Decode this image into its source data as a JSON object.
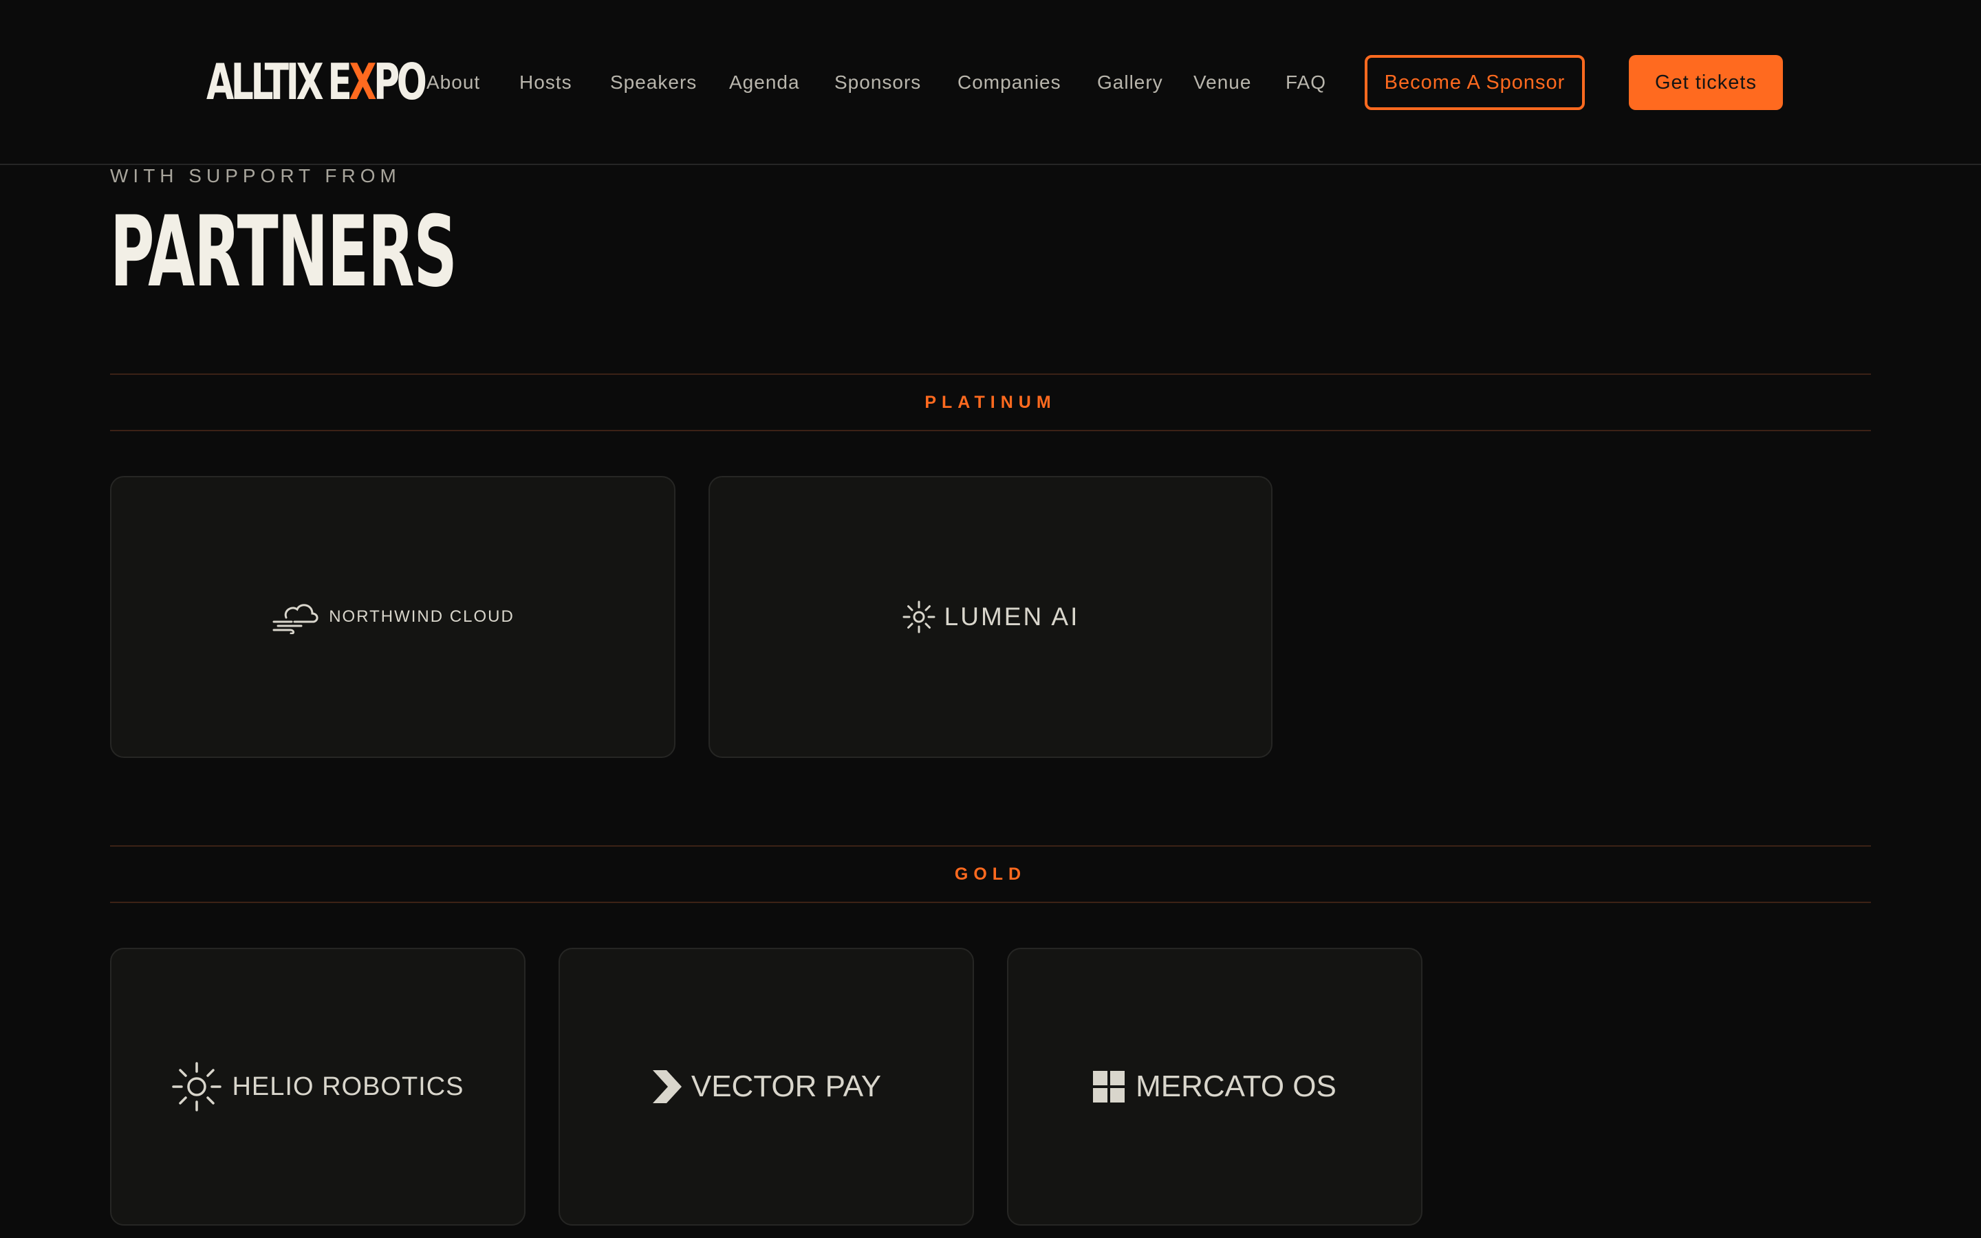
{
  "header": {
    "logo": {
      "part1": "ALLTIX",
      "part2_pre": "E",
      "part2_accent": "X",
      "part2_post": "PO"
    },
    "nav": [
      "About",
      "Hosts",
      "Speakers",
      "Agenda",
      "Sponsors",
      "Companies",
      "Gallery",
      "Venue",
      "FAQ"
    ],
    "become_sponsor_label": "Become A Sponsor",
    "get_tickets_label": "Get tickets"
  },
  "section": {
    "eyebrow": "WITH SUPPORT FROM",
    "title": "PARTNERS"
  },
  "tiers": [
    {
      "label": "PLATINUM",
      "partners": [
        {
          "name": "NORTHWIND CLOUD",
          "icon": "cloud-wind-icon"
        },
        {
          "name": "LUMEN AI",
          "icon": "sun-icon"
        }
      ]
    },
    {
      "label": "GOLD",
      "partners": [
        {
          "name": "HELIO ROBOTICS",
          "icon": "sun-icon"
        },
        {
          "name": "VECTOR PAY",
          "icon": "chevron-arrow-icon"
        },
        {
          "name": "MERCATO OS",
          "icon": "grid-squares-icon"
        }
      ]
    }
  ],
  "colors": {
    "background": "#0b0b0b",
    "accent": "#ff6a1f",
    "card": "#141412",
    "text": "#f2efe6",
    "muted": "#b9b6ad"
  }
}
